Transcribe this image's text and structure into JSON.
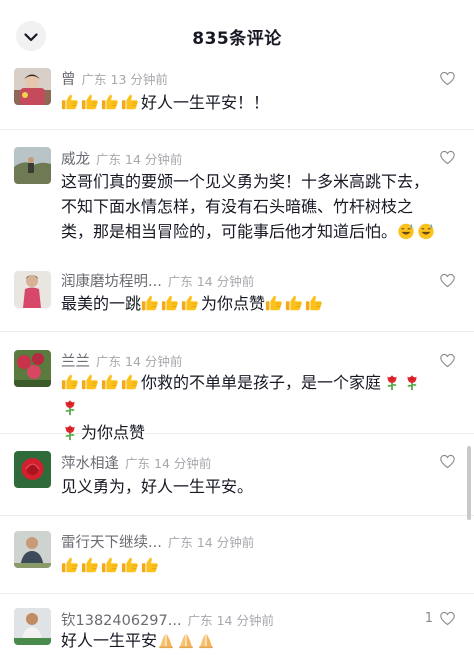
{
  "header": {
    "title": "835条评论",
    "collapse_icon": "chevron-down-icon"
  },
  "comments": [
    {
      "user": "曾",
      "location": "广东",
      "time": "13 分钟前",
      "prefix_emojis": [
        "thumbs-up",
        "thumbs-up",
        "thumbs-up",
        "thumbs-up"
      ],
      "text": "好人一生平安！！",
      "likes": ""
    },
    {
      "user": "威龙",
      "location": "广东",
      "time": "14 分钟前",
      "text": "这哥们真的要颁一个见义勇为奖！十多米高跳下去，\n不知下面水情怎样，有没有石头暗礁、竹杆树枝之\n类，那是相当冒险的，可能事后他才知道后怕。",
      "suffix_emojis": [
        "sweat-laugh",
        "sweat-laugh"
      ],
      "likes": ""
    },
    {
      "user": "润康磨坊程明...",
      "location": "广东",
      "time": "14 分钟前",
      "text": "最美的一跳",
      "mid_emojis": [
        "thumbs-up",
        "thumbs-up",
        "thumbs-up"
      ],
      "text2": "为你点赞",
      "suffix_emojis": [
        "thumbs-up",
        "thumbs-up",
        "thumbs-up"
      ],
      "likes": ""
    },
    {
      "user": "兰兰",
      "location": "广东",
      "time": "14 分钟前",
      "prefix_emojis": [
        "thumbs-up",
        "thumbs-up",
        "thumbs-up",
        "thumbs-up"
      ],
      "text": "你救的不单单是孩子，是一个家庭",
      "suffix_emojis": [
        "rose",
        "rose",
        "rose"
      ],
      "line2_emojis": [
        "rose"
      ],
      "text2": "为你点赞",
      "likes": ""
    },
    {
      "user": "萍水相逢",
      "location": "广东",
      "time": "14 分钟前",
      "text": "见义勇为，好人一生平安。",
      "likes": ""
    },
    {
      "user": "雷行天下继续...",
      "location": "广东",
      "time": "14 分钟前",
      "prefix_emojis": [
        "thumbs-up",
        "thumbs-up",
        "thumbs-up",
        "thumbs-up",
        "thumbs-up"
      ],
      "text": "",
      "likes": ""
    },
    {
      "user": "钦1382406297...",
      "location": "广东",
      "time": "14 分钟前",
      "text": "好人一生平安",
      "suffix_emojis": [
        "pray",
        "pray",
        "pray"
      ],
      "likes": "1"
    }
  ],
  "icons": {
    "like": "heart-outline-icon",
    "thumbs_up": "thumbs-up-emoji",
    "rose": "rose-emoji",
    "sweat_laugh": "sweat-laugh-emoji",
    "pray": "pray-emoji"
  },
  "colors": {
    "name": "#6b6b73",
    "meta": "#a7a7ad",
    "text": "#161823",
    "divider": "#ececec"
  }
}
